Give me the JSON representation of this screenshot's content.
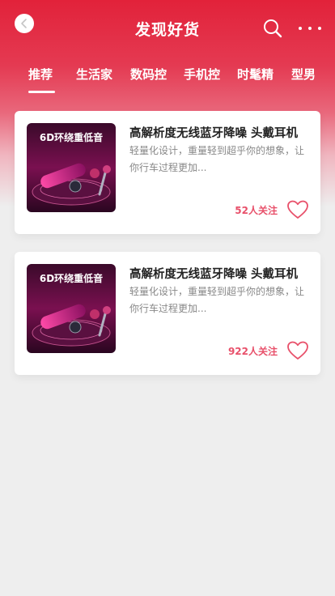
{
  "header": {
    "title": "发现好货",
    "back_icon": "chevron-left-icon",
    "search_icon": "search-icon",
    "more_icon": "more-horizontal-icon"
  },
  "tabs": [
    {
      "label": "推荐",
      "active": true
    },
    {
      "label": "生活家",
      "active": false
    },
    {
      "label": "数码控",
      "active": false
    },
    {
      "label": "手机控",
      "active": false
    },
    {
      "label": "时髦精",
      "active": false
    },
    {
      "label": "型男",
      "active": false
    }
  ],
  "products": [
    {
      "image_caption": "6D环绕重低音",
      "title": "高解析度无线蓝牙降噪 头戴耳机",
      "description": "轻量化设计，重量轻到超乎你的想象，让你行车过程更加...",
      "follow": "52人关注"
    },
    {
      "image_caption": "6D环绕重低音",
      "title": "高解析度无线蓝牙降噪 头戴耳机",
      "description": "轻量化设计，重量轻到超乎你的想象，让你行车过程更加...",
      "follow": "922人关注"
    }
  ],
  "colors": {
    "brand_red": "#e2223a",
    "accent_pink": "#e8506a",
    "background": "#eeeeee"
  }
}
